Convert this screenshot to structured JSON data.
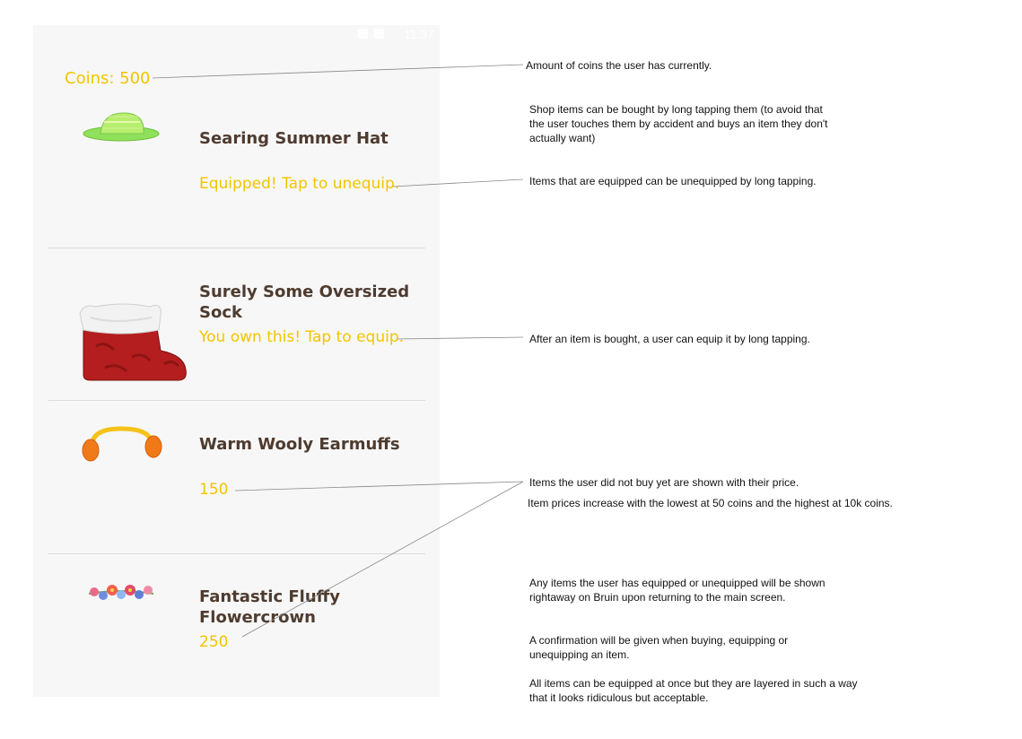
{
  "status_bar": {
    "time": "11:37"
  },
  "coins_label": "Coins: 500",
  "items": [
    {
      "name": "Searing Summer Hat",
      "status": "Equipped! Tap to unequip."
    },
    {
      "name": "Surely Some Oversized Sock",
      "status": "You own this! Tap to equip."
    },
    {
      "name": "Warm Wooly Earmuffs",
      "status": "150"
    },
    {
      "name": "Fantastic Fluffy Flowercrown",
      "status": "250"
    }
  ],
  "annotations": {
    "coins": "Amount of coins the user has currently.",
    "long_tap": "Shop items can be bought by long tapping them (to avoid that the user touches them by accident and buys an item they don't actually want)",
    "unequip": "Items that are equipped can be unequipped by long tapping.",
    "equip": "After an item is bought, a user can equip it by long tapping.",
    "price": "Items the user did not buy yet are shown with their price.",
    "price_range": "Item prices increase with the lowest at 50 coins and the highest at 10k coins.",
    "bruin": "Any items the user has equipped or unequipped will be shown rightaway on Bruin upon returning to the main screen.",
    "confirmation": "A confirmation will be given when buying, equipping or unequipping an item.",
    "layering": "All items can be equipped at once but they are layered in such a way that it looks ridiculous but acceptable."
  },
  "colors": {
    "accent": "#f3c400",
    "item_name": "#4e3b2f",
    "background": "#f7f7f7"
  }
}
